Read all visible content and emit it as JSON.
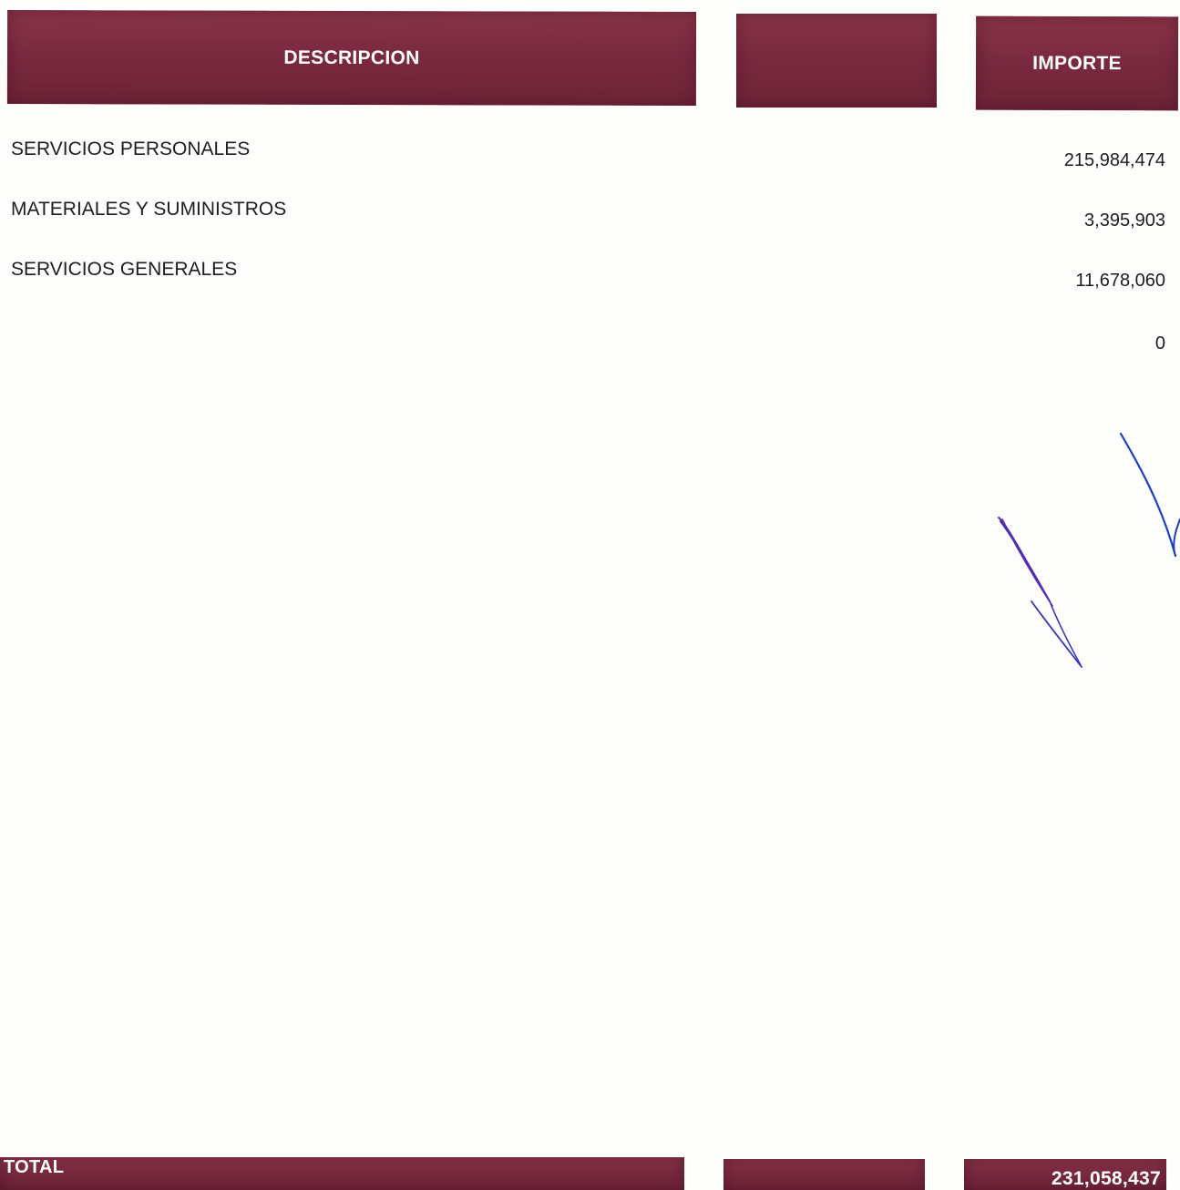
{
  "header": {
    "description_label": "DESCRIPCION",
    "middle_label": "",
    "amount_label": "IMPORTE"
  },
  "rows": [
    {
      "label": "SERVICIOS PERSONALES",
      "amount": "215,984,474"
    },
    {
      "label": "MATERIALES Y SUMINISTROS",
      "amount": "3,395,903"
    },
    {
      "label": "SERVICIOS GENERALES",
      "amount": "11,678,060"
    },
    {
      "label": "",
      "amount": "0"
    }
  ],
  "footer": {
    "total_label": "TOTAL",
    "total_amount": "231,058,437"
  },
  "colors": {
    "band": "#7a2a3f",
    "signature_ink": "#1f3fbf"
  }
}
